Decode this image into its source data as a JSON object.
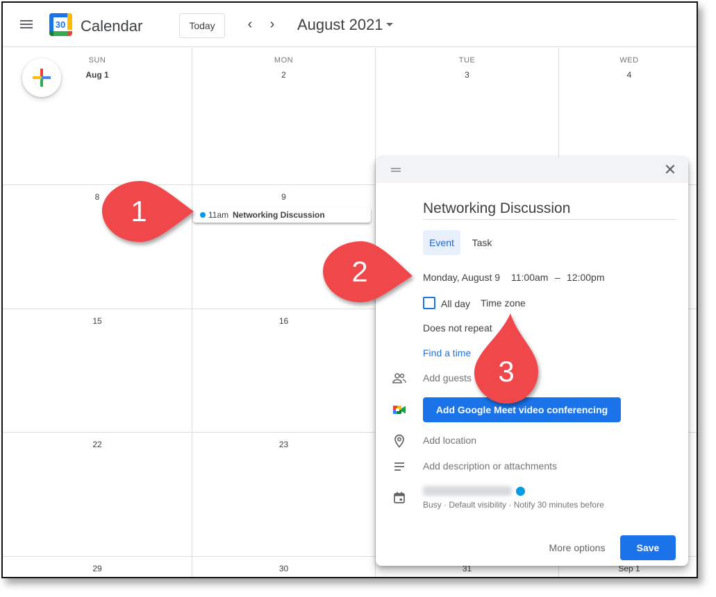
{
  "header": {
    "app_title": "Calendar",
    "logo_day": "30",
    "today_label": "Today",
    "prev_glyph": "‹",
    "next_glyph": "›",
    "month_title": "August 2021"
  },
  "weekdays": [
    "SUN",
    "MON",
    "TUE",
    "WED"
  ],
  "weeks": [
    [
      "Aug 1",
      "2",
      "3",
      "4"
    ],
    [
      "8",
      "9",
      "",
      ""
    ],
    [
      "15",
      "16",
      "",
      ""
    ],
    [
      "22",
      "23",
      "",
      ""
    ],
    [
      "29",
      "30",
      "31",
      "Sep 1"
    ]
  ],
  "event_chip": {
    "time": "11am",
    "title": "Networking Discussion",
    "color": "#039be5"
  },
  "dialog": {
    "close_glyph": "✕",
    "title_value": "Networking Discussion",
    "tabs": [
      "Event",
      "Task"
    ],
    "date": "Monday, August 9",
    "start_time": "11:00am",
    "dash": "–",
    "end_time": "12:00pm",
    "all_day_label": "All day",
    "time_zone_label": "Time zone",
    "repeat_label": "Does not repeat",
    "find_time_label": "Find a time",
    "add_guests_placeholder": "Add guests",
    "meet_button_label": "Add Google Meet video conferencing",
    "add_location_placeholder": "Add location",
    "add_description_placeholder": "Add description or attachments",
    "calendar_meta": "Busy · Default visibility · Notify 30 minutes before",
    "more_options_label": "More options",
    "save_label": "Save"
  },
  "callouts": [
    "1",
    "2",
    "3"
  ],
  "colors": {
    "accent": "#1a73e8",
    "callout_red": "#f0464b",
    "grid_line": "#dadce0"
  }
}
